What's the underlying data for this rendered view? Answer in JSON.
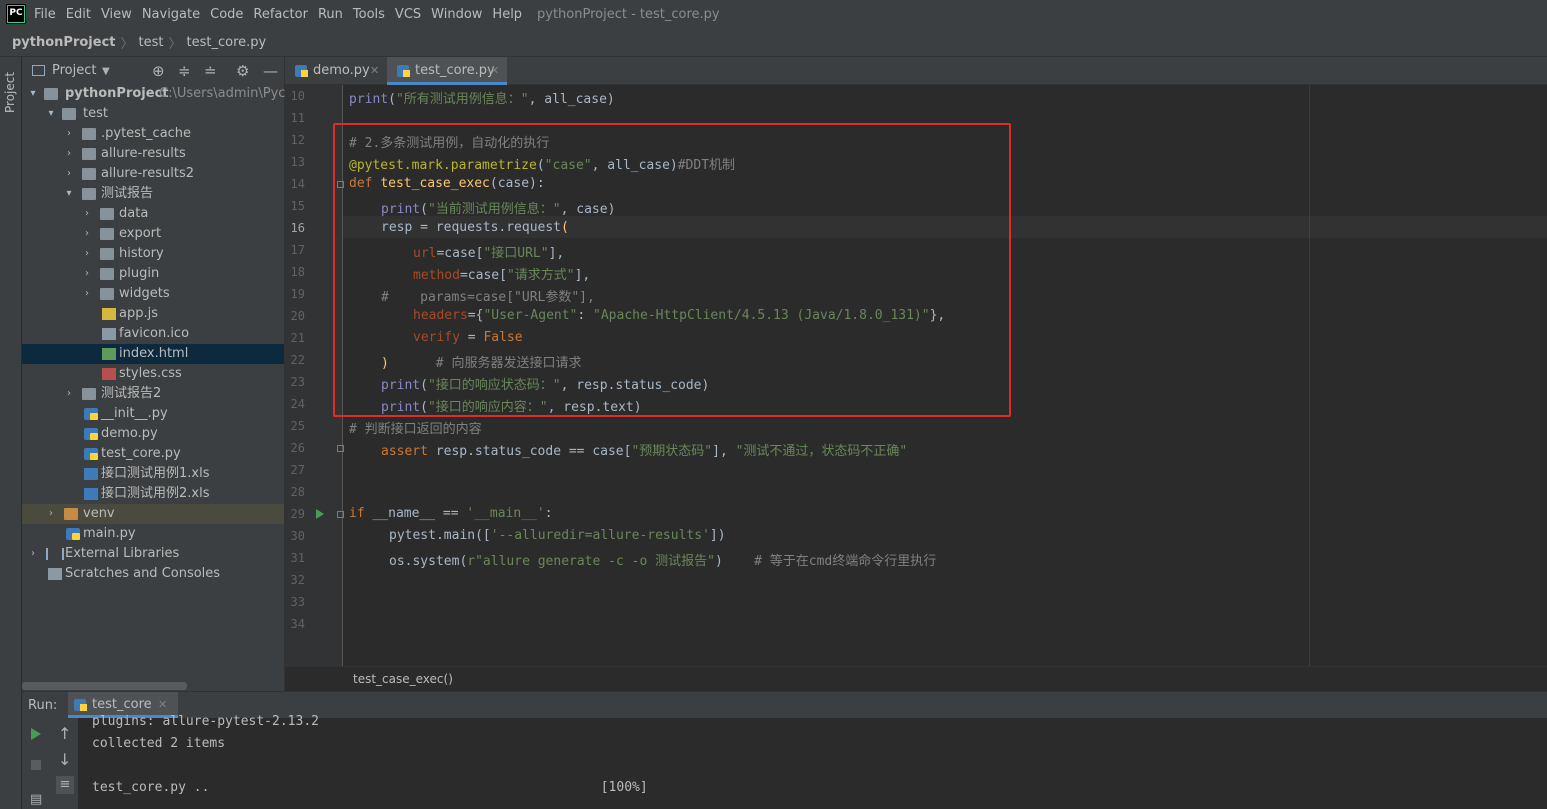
{
  "menubar": {
    "logo": "PC",
    "items": [
      "File",
      "Edit",
      "View",
      "Navigate",
      "Code",
      "Refactor",
      "Run",
      "Tools",
      "VCS",
      "Window",
      "Help"
    ],
    "window_title": "pythonProject - test_core.py"
  },
  "breadcrumb": [
    "pythonProject",
    "test",
    "test_core.py"
  ],
  "left_stripe": {
    "project_label": "Project"
  },
  "project_panel": {
    "title": "Project",
    "root_path": "C:\\Users\\admin\\Pycha",
    "tree": [
      {
        "label": "pythonProject",
        "icon": "folder-icon"
      },
      {
        "label": "test",
        "icon": "folder-icon"
      },
      {
        "label": ".pytest_cache",
        "icon": "folder-icon"
      },
      {
        "label": "allure-results",
        "icon": "folder-icon"
      },
      {
        "label": "allure-results2",
        "icon": "folder-icon"
      },
      {
        "label": "测试报告",
        "icon": "folder-icon"
      },
      {
        "label": "data",
        "icon": "folder-icon"
      },
      {
        "label": "export",
        "icon": "folder-icon"
      },
      {
        "label": "history",
        "icon": "folder-icon"
      },
      {
        "label": "plugin",
        "icon": "folder-icon"
      },
      {
        "label": "widgets",
        "icon": "folder-icon"
      },
      {
        "label": "app.js",
        "icon": "js-file-icon"
      },
      {
        "label": "favicon.ico",
        "icon": "image-file-icon"
      },
      {
        "label": "index.html",
        "icon": "html-file-icon"
      },
      {
        "label": "styles.css",
        "icon": "css-file-icon"
      },
      {
        "label": "测试报告2",
        "icon": "folder-icon"
      },
      {
        "label": "__init__.py",
        "icon": "python-file-icon"
      },
      {
        "label": "demo.py",
        "icon": "python-file-icon"
      },
      {
        "label": "test_core.py",
        "icon": "python-file-icon"
      },
      {
        "label": "接口测试用例1.xls",
        "icon": "excel-file-icon"
      },
      {
        "label": "接口测试用例2.xls",
        "icon": "excel-file-icon"
      },
      {
        "label": "venv",
        "icon": "folder-icon"
      },
      {
        "label": "main.py",
        "icon": "python-file-icon"
      },
      {
        "label": "External Libraries",
        "icon": "library-icon"
      },
      {
        "label": "Scratches and Consoles",
        "icon": "scratches-icon"
      }
    ]
  },
  "editor": {
    "tabs": [
      {
        "label": "demo.py",
        "active": false
      },
      {
        "label": "test_core.py",
        "active": true
      }
    ],
    "line_numbers": [
      "10",
      "11",
      "12",
      "13",
      "14",
      "15",
      "16",
      "17",
      "18",
      "19",
      "20",
      "21",
      "22",
      "23",
      "24",
      "25",
      "26",
      "27",
      "28",
      "29",
      "30",
      "31",
      "32",
      "33",
      "34"
    ],
    "code_breadcrumb": "test_case_exec()",
    "code": {
      "l10": {
        "a": "print",
        "b": "(",
        "c": "\"所有测试用例信息：\"",
        ".d": "",
        "d": ", all_case)"
      },
      "l12": "# 2.多条测试用例，自动化的执行",
      "l13": {
        "dec": "@pytest.mark.parametrize",
        "open": "(",
        "s": "\"case\"",
        "rest": ", all_case)",
        "cm": "#DDT机制"
      },
      "l14": {
        "kw": "def ",
        "fn": "test_case_exec",
        "rest": "(case):"
      },
      "l15": {
        "bi": "print",
        "a": "(",
        "s": "\"当前测试用例信息：\"",
        "rest": ", case)"
      },
      "l16": {
        "a": "resp = requests.request",
        "b": "("
      },
      "l17": {
        "k": "url",
        "a": "=case[",
        "s": "\"接口URL\"",
        "b": "],"
      },
      "l18": {
        "k": "method",
        "a": "=case[",
        "s": "\"请求方式\"",
        "b": "],"
      },
      "l19": "#    params=case[\"URL参数\"],",
      "l20": {
        "k": "headers",
        "a": "={",
        "s1": "\"User-Agent\"",
        "b": ": ",
        "s2": "\"Apache-HttpClient/4.5.13 (Java/1.8.0_131)\"",
        "c": "},"
      },
      "l21": {
        "k": "verify",
        "a": " = ",
        "kw": "False"
      },
      "l22": {
        "a": ")",
        "cm": "# 向服务器发送接口请求"
      },
      "l23": {
        "bi": "print",
        "a": "(",
        "s": "\"接口的响应状态码：\"",
        "rest": ", resp.status_code)"
      },
      "l24": {
        "bi": "print",
        "a": "(",
        "s": "\"接口的响应内容：\"",
        "rest": ", resp.text)"
      },
      "l25": "# 判断接口返回的内容",
      "l26": {
        "kw": "assert ",
        "a": "resp.status_code == case[",
        "s1": "\"预期状态码\"",
        "b": "], ",
        "s2": "\"测试不通过，状态码不正确\""
      },
      "l29": {
        "kw": "if ",
        "a": "__name__ == ",
        "s": "'__main__'",
        "b": ":"
      },
      "l30": {
        "a": "pytest.main([",
        "s": "'--alluredir=allure-results'",
        "b": "])"
      },
      "l31": {
        "a": "os.system(",
        "s": "r\"allure generate -c -o 测试报告\"",
        "b": ")",
        "cm": "# 等于在cmd终端命令行里执行"
      }
    }
  },
  "run_panel": {
    "label": "Run:",
    "tab": "test_core",
    "output": [
      "plugins: allure-pytest-2.13.2",
      "collected 2 items",
      "",
      "test_core.py ..                                                  [100%]"
    ]
  },
  "colors": {
    "accent": "#4a88c7",
    "highlight_box": "#e02b2b",
    "run_green": "#499c54"
  }
}
